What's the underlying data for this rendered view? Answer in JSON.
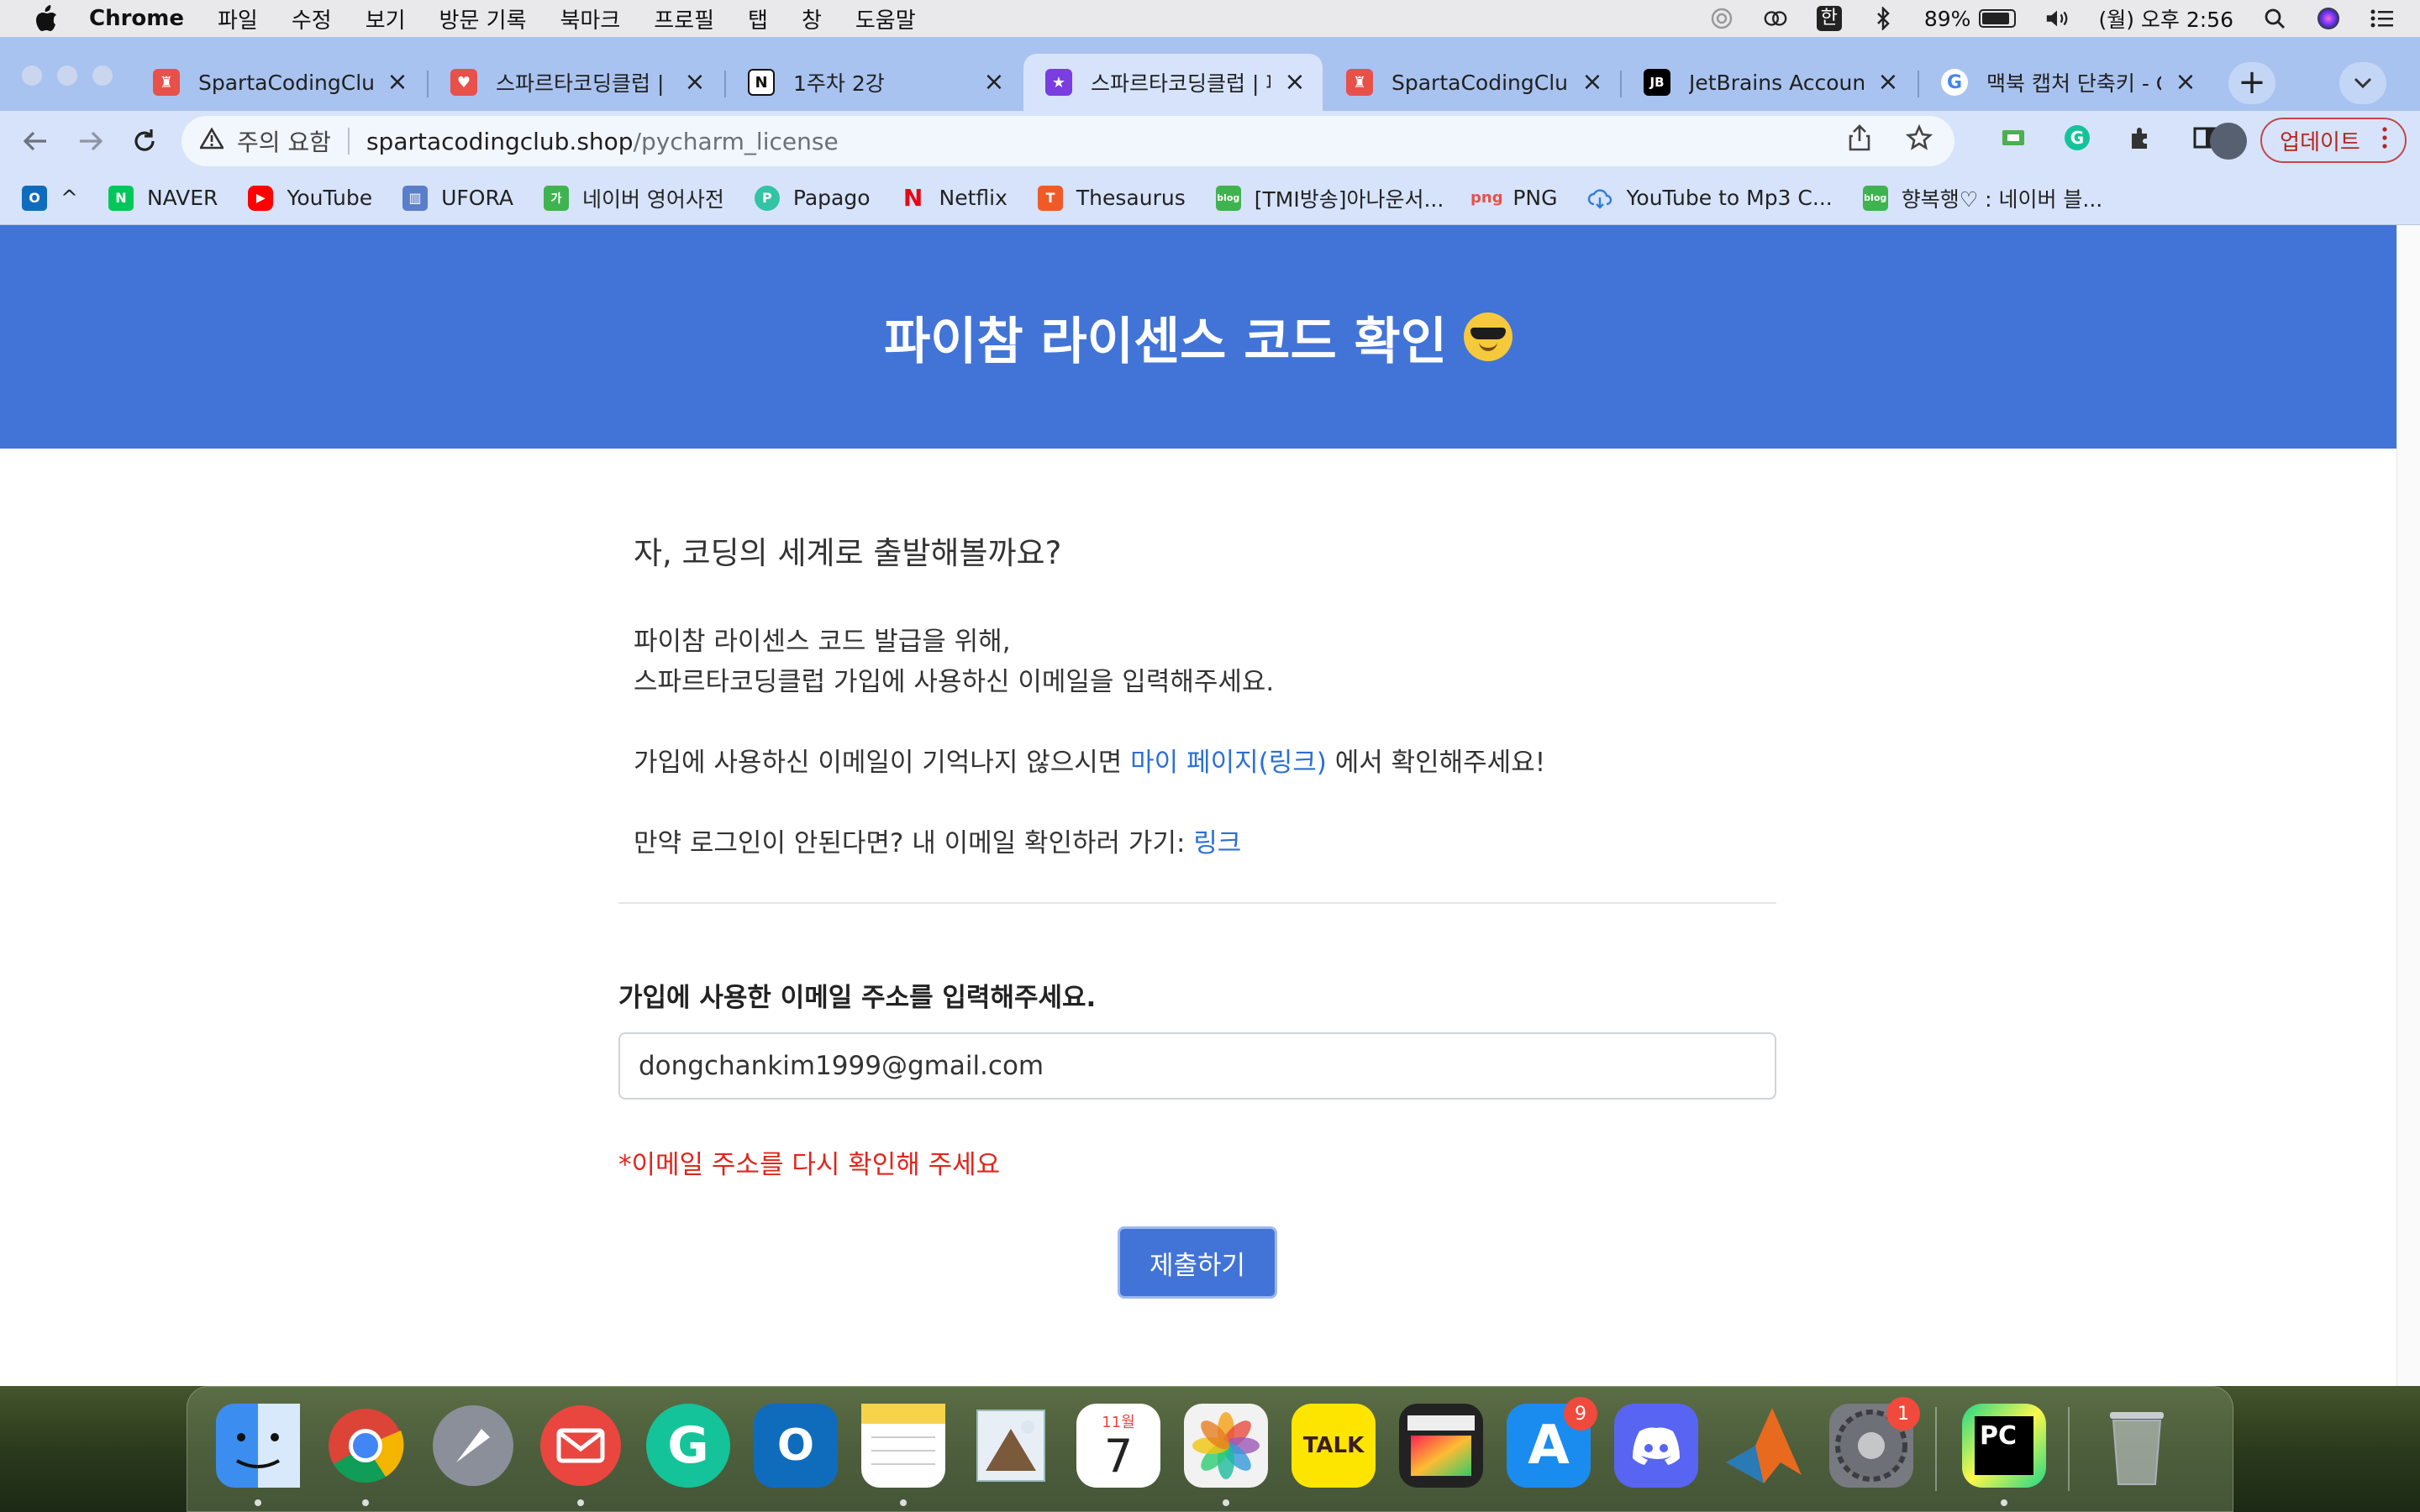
{
  "menubar": {
    "app_name": "Chrome",
    "menus": [
      "파일",
      "수정",
      "보기",
      "방문 기록",
      "북마크",
      "프로필",
      "탭",
      "창",
      "도움말"
    ],
    "ime_label": "한",
    "battery_percent": "89%",
    "battery_level": 0.89,
    "clock": "(월) 오후 2:56"
  },
  "tabs": [
    {
      "title": "SpartaCodingClub",
      "favicon_color": "#e8504a",
      "favicon": "spartan-icon"
    },
    {
      "title": "스파르타코딩클럽 | 커뮤",
      "favicon_color": "#e8504a",
      "favicon": "heart-code-icon"
    },
    {
      "title": "1주차 2강",
      "favicon_color": "#222222",
      "favicon": "notion-icon"
    },
    {
      "title": "스파르타코딩클럽 | 파이",
      "favicon_color": "#7a3de0",
      "favicon": "sparta-lecture-icon"
    },
    {
      "title": "SpartaCodingClub",
      "favicon_color": "#e8504a",
      "favicon": "spartan-icon"
    },
    {
      "title": "JetBrains Account",
      "favicon_color": "#000000",
      "favicon": "jetbrains-icon"
    },
    {
      "title": "맥북 캡처 단축키 - Goo",
      "favicon_color": "#ffffff",
      "favicon": "google-icon"
    }
  ],
  "omnibox": {
    "security_label": "주의 요함",
    "domain": "spartacodingclub.shop",
    "path": "/pycharm_license"
  },
  "update_label": "업데이트",
  "bookmarks": [
    {
      "label": "^",
      "icon": "outlook-icon",
      "color": "#0f6cbd"
    },
    {
      "label": "NAVER",
      "icon": "naver-icon",
      "color": "#03c75a"
    },
    {
      "label": "YouTube",
      "icon": "youtube-icon",
      "color": "#ff0000"
    },
    {
      "label": "UFORA",
      "icon": "university-icon",
      "color": "#5a7ec8"
    },
    {
      "label": "네이버 영어사전",
      "icon": "naver-dict-icon",
      "color": "#3fb34f"
    },
    {
      "label": "Papago",
      "icon": "papago-icon",
      "color": "#33c3a5"
    },
    {
      "label": "Netflix",
      "icon": "netflix-icon",
      "color": "#e50914"
    },
    {
      "label": "Thesaurus",
      "icon": "thesaurus-icon",
      "color": "#f05a28"
    },
    {
      "label": "[TMI방송]아나운서...",
      "icon": "blog-icon",
      "color": "#3fb34f"
    },
    {
      "label": "PNG",
      "icon": "png-icon",
      "color": "#e8504a"
    },
    {
      "label": "YouTube to Mp3 C...",
      "icon": "download-cloud-icon",
      "color": "#2f7fd8"
    },
    {
      "label": "향복행♡ : 네이버 블...",
      "icon": "blog-icon",
      "color": "#3fb34f"
    }
  ],
  "page": {
    "title": "파이참 라이센스 코드 확인",
    "lead": "자, 코딩의 세계로 출발해볼까요?",
    "para1_line1": "파이참 라이센스 코드 발급을 위해,",
    "para1_line2": "스파르타코딩클럽 가입에 사용하신 이메일을 입력해주세요.",
    "para2_before": "가입에 사용하신 이메일이 기억나지 않으시면 ",
    "para2_link": "마이 페이지(링크)",
    "para2_after": " 에서 확인해주세요!",
    "para3_before": "만약 로그인이 안된다면? 내 이메일 확인하러 가기: ",
    "para3_link": "링크",
    "email_label": "가입에 사용한 이메일 주소를 입력해주세요.",
    "email_value": "dongchankim1999@gmail.com",
    "error_text": "*이메일 주소를 다시 확인해 주세요",
    "submit_label": "제출하기",
    "accent_color": "#4274d7",
    "error_color": "#e0251b"
  },
  "dock": {
    "apps": [
      {
        "name": "finder-icon",
        "label": "",
        "color": "#3b8ef0",
        "running": true
      },
      {
        "name": "chrome-icon",
        "label": "",
        "color": "#ffffff",
        "running": true
      },
      {
        "name": "launchpad-icon",
        "label": "",
        "color": "#8a8f99",
        "running": false
      },
      {
        "name": "mail-icon",
        "label": "",
        "color": "#e8463f",
        "running": true
      },
      {
        "name": "grammarly-icon",
        "label": "G",
        "color": "#15c39a",
        "running": false
      },
      {
        "name": "outlook-icon",
        "label": "O",
        "color": "#0f6cbd",
        "running": false
      },
      {
        "name": "notes-icon",
        "label": "",
        "color": "#fbe27a",
        "running": true
      },
      {
        "name": "preview-icon",
        "label": "",
        "color": "#6b9bd6",
        "running": false
      },
      {
        "name": "calendar-icon",
        "label": "7",
        "color": "#ffffff",
        "month": "11월",
        "running": false
      },
      {
        "name": "photos-icon",
        "label": "",
        "color": "#f2f2f2",
        "running": true
      },
      {
        "name": "kakaotalk-icon",
        "label": "TALK",
        "color": "#fee500",
        "running": false
      },
      {
        "name": "final-cut-icon",
        "label": "",
        "color": "#2b2b2b",
        "running": false
      },
      {
        "name": "app-store-icon",
        "label": "A",
        "color": "#1a8cf0",
        "badge": "9",
        "running": false
      },
      {
        "name": "discord-icon",
        "label": "",
        "color": "#5865f2",
        "running": false
      },
      {
        "name": "matlab-icon",
        "label": "",
        "color": "#e86a1f",
        "running": false
      },
      {
        "name": "system-preferences-icon",
        "label": "",
        "color": "#777a80",
        "badge": "1",
        "running": false
      },
      {
        "name": "pycharm-icon",
        "label": "PC",
        "color": "#1c1c1c",
        "running": true
      },
      {
        "name": "trash-icon",
        "label": "",
        "color": "#9aa0a6",
        "running": false
      }
    ]
  }
}
